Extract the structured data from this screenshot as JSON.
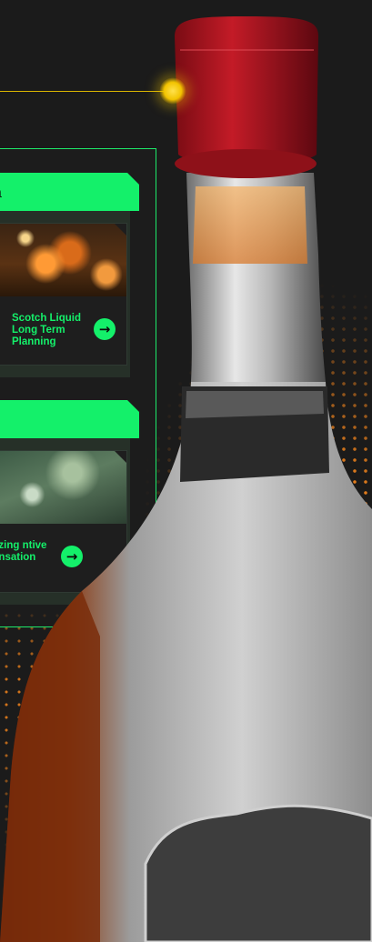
{
  "groups": [
    {
      "header": "n",
      "card": {
        "title": "Scotch Liquid Long Term Planning",
        "button_icon": "arrow-right-icon",
        "image": "whisky-glasses-photo"
      }
    },
    {
      "header": "",
      "card": {
        "title": "mizing ntive pensation",
        "button_icon": "arrow-right-icon",
        "image": "person-in-forest-photo"
      }
    }
  ],
  "colors": {
    "accent_green": "#14f06a",
    "background": "#1b1b1b",
    "connector_yellow": "#d9b400",
    "dot_orange": "#ff8a1c",
    "bottle_cap_red": "#b3121f"
  },
  "icons": {
    "arrow": "→"
  }
}
